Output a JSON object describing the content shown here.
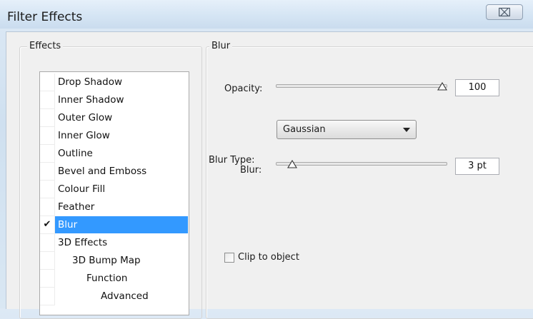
{
  "window": {
    "title": "Filter Effects",
    "close_glyph": "⌧"
  },
  "effects": {
    "group_label": "Effects",
    "items": [
      {
        "label": "Drop Shadow",
        "checked": false,
        "selected": false,
        "level": 0
      },
      {
        "label": "Inner Shadow",
        "checked": false,
        "selected": false,
        "level": 0
      },
      {
        "label": "Outer Glow",
        "checked": false,
        "selected": false,
        "level": 0
      },
      {
        "label": "Inner Glow",
        "checked": false,
        "selected": false,
        "level": 0
      },
      {
        "label": "Outline",
        "checked": false,
        "selected": false,
        "level": 0
      },
      {
        "label": "Bevel and Emboss",
        "checked": false,
        "selected": false,
        "level": 0
      },
      {
        "label": "Colour Fill",
        "checked": false,
        "selected": false,
        "level": 0
      },
      {
        "label": "Feather",
        "checked": false,
        "selected": false,
        "level": 0
      },
      {
        "label": "Blur",
        "checked": true,
        "selected": true,
        "level": 0
      },
      {
        "label": "3D Effects",
        "checked": false,
        "selected": false,
        "level": 0
      },
      {
        "label": "3D Bump Map",
        "checked": false,
        "selected": false,
        "level": 1
      },
      {
        "label": "Function",
        "checked": false,
        "selected": false,
        "level": 2
      },
      {
        "label": "Advanced",
        "checked": false,
        "selected": false,
        "level": 3
      }
    ],
    "check_glyph": "✔"
  },
  "blur_panel": {
    "group_label": "Blur",
    "opacity": {
      "label": "Opacity:",
      "value": "100",
      "level_percent": 100
    },
    "blur_type": {
      "label": "Blur Type:",
      "selected": "Gaussian"
    },
    "blur": {
      "label": "Blur:",
      "value": "3 pt",
      "level_percent": 7
    },
    "clip": {
      "label": "Clip to object",
      "checked": false
    }
  }
}
